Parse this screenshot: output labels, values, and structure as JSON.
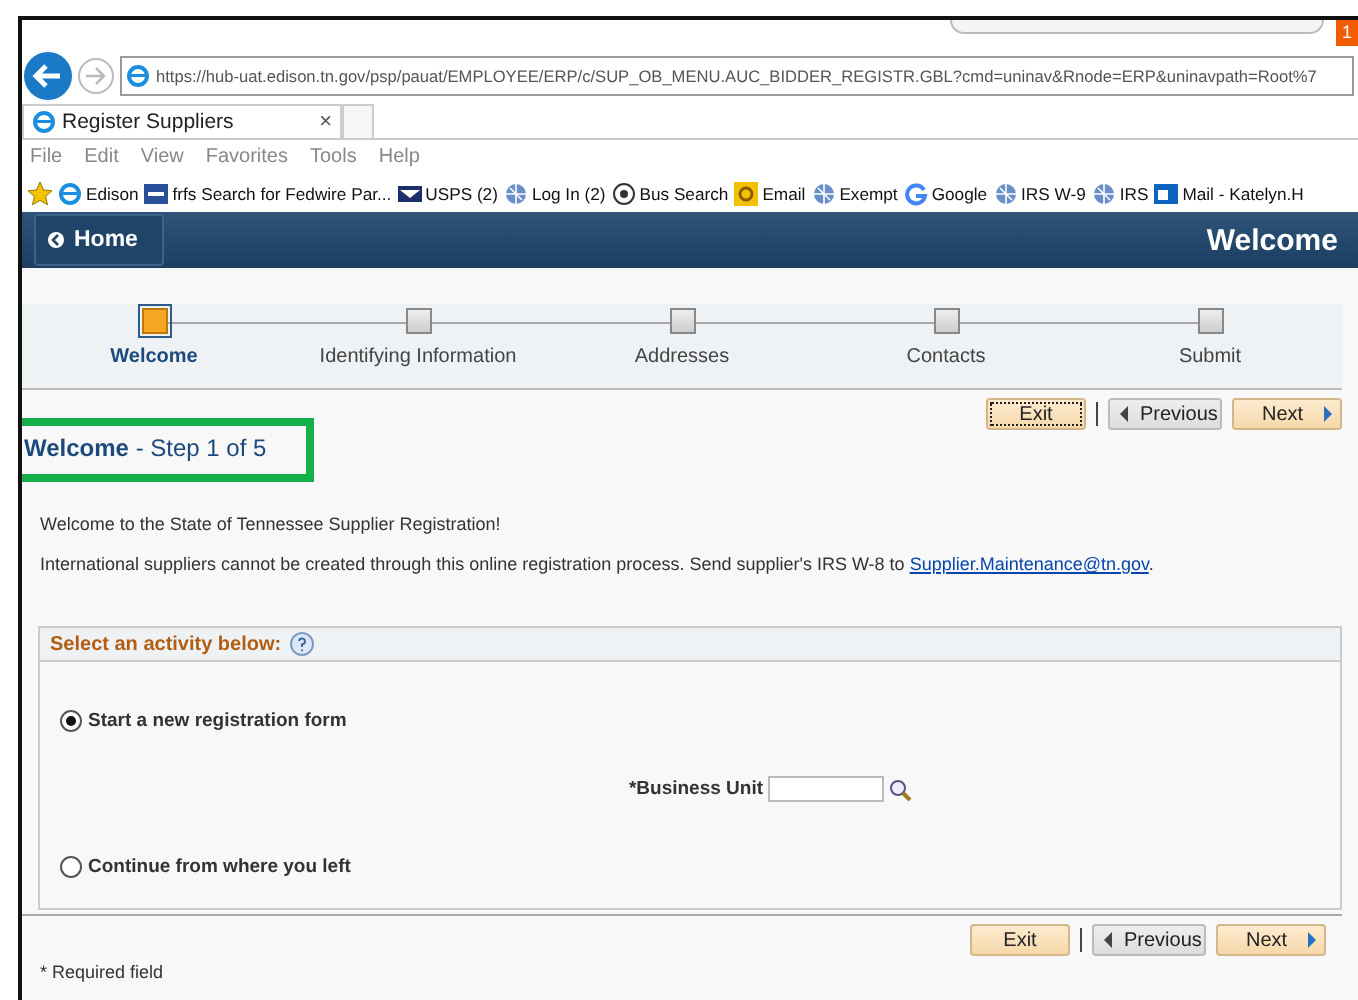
{
  "browser": {
    "badge": "1",
    "url": "https://hub-uat.edison.tn.gov/psp/pauat/EMPLOYEE/ERP/c/SUP_OB_MENU.AUC_BIDDER_REGISTR.GBL?cmd=uninav&Rnode=ERP&uninavpath=Root%7",
    "tab_title": "Register Suppliers",
    "tab_close": "×",
    "menu": [
      "File",
      "Edit",
      "View",
      "Favorites",
      "Tools",
      "Help"
    ],
    "favorites": [
      {
        "label": "Edison",
        "kind": "ie"
      },
      {
        "label": "frfs Search for Fedwire Par...",
        "kind": "fed"
      },
      {
        "label": "USPS (2)",
        "kind": "usps"
      },
      {
        "label": "Log In (2)",
        "kind": "globe"
      },
      {
        "label": "Bus Search",
        "kind": "ball"
      },
      {
        "label": "Email",
        "kind": "outlook"
      },
      {
        "label": "Exempt",
        "kind": "globe"
      },
      {
        "label": "Google",
        "kind": "google"
      },
      {
        "label": "IRS W-9",
        "kind": "globe"
      },
      {
        "label": "IRS",
        "kind": "globe"
      },
      {
        "label": "Mail - Katelyn.H",
        "kind": "mail"
      }
    ]
  },
  "header": {
    "home_button": "Home",
    "title": "Welcome"
  },
  "steps": [
    {
      "label": "Welcome",
      "selected": true
    },
    {
      "label": "Identifying Information",
      "selected": false
    },
    {
      "label": "Addresses",
      "selected": false
    },
    {
      "label": "Contacts",
      "selected": false
    },
    {
      "label": "Submit",
      "selected": false
    }
  ],
  "top_buttons": [
    {
      "label": "Exit",
      "kind": "exit",
      "focused": true
    },
    {
      "label": "Previous",
      "kind": "previous",
      "focused": false
    },
    {
      "label": "Next",
      "kind": "next",
      "focused": false
    }
  ],
  "page_title": {
    "title": "Welcome",
    "step": "- Step 1 of 5",
    "highlighted": true
  },
  "intro": {
    "welcome": "Welcome to the State of Tennessee Supplier Registration!",
    "notice": "International suppliers cannot be created through this online registration process. Send supplier's IRS W-8 to",
    "link": "Supplier.Maintenance@tn.gov",
    "after_link": "."
  },
  "activity": {
    "title": "Select an activity below:",
    "options": [
      {
        "label": "Start a new registration form",
        "selected": true,
        "field": {
          "label": "*Business Unit"
        }
      },
      {
        "label": "Continue from where you left",
        "selected": false
      }
    ]
  },
  "bottom_buttons": [
    {
      "label": "Exit",
      "kind": "exit",
      "focused": false
    },
    {
      "label": "Previous",
      "kind": "previous",
      "focused": false
    },
    {
      "label": "Next",
      "kind": "next",
      "focused": false
    }
  ],
  "footer": {
    "note": "* Required field"
  }
}
